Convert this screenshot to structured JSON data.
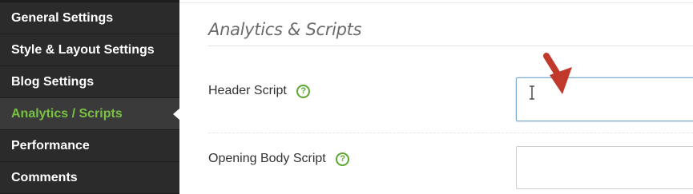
{
  "sidebar": {
    "items": [
      {
        "label": "General Settings"
      },
      {
        "label": "Style & Layout Settings"
      },
      {
        "label": "Blog Settings"
      },
      {
        "label": "Analytics / Scripts"
      },
      {
        "label": "Performance"
      },
      {
        "label": "Comments"
      }
    ],
    "active_index": 3
  },
  "main": {
    "section_title": "Analytics & Scripts",
    "fields": [
      {
        "label": "Header Script",
        "help_icon": "?",
        "value": ""
      },
      {
        "label": "Opening Body Script",
        "help_icon": "?",
        "value": ""
      }
    ]
  },
  "colors": {
    "sidebar_bg": "#2b2b2b",
    "active_text": "#79c142",
    "help_icon": "#5aa832",
    "annotation_arrow": "#c0392b"
  },
  "icons": {
    "help": "question-circle-icon",
    "cursor": "text-cursor-icon",
    "annotation": "red-arrow-icon"
  }
}
